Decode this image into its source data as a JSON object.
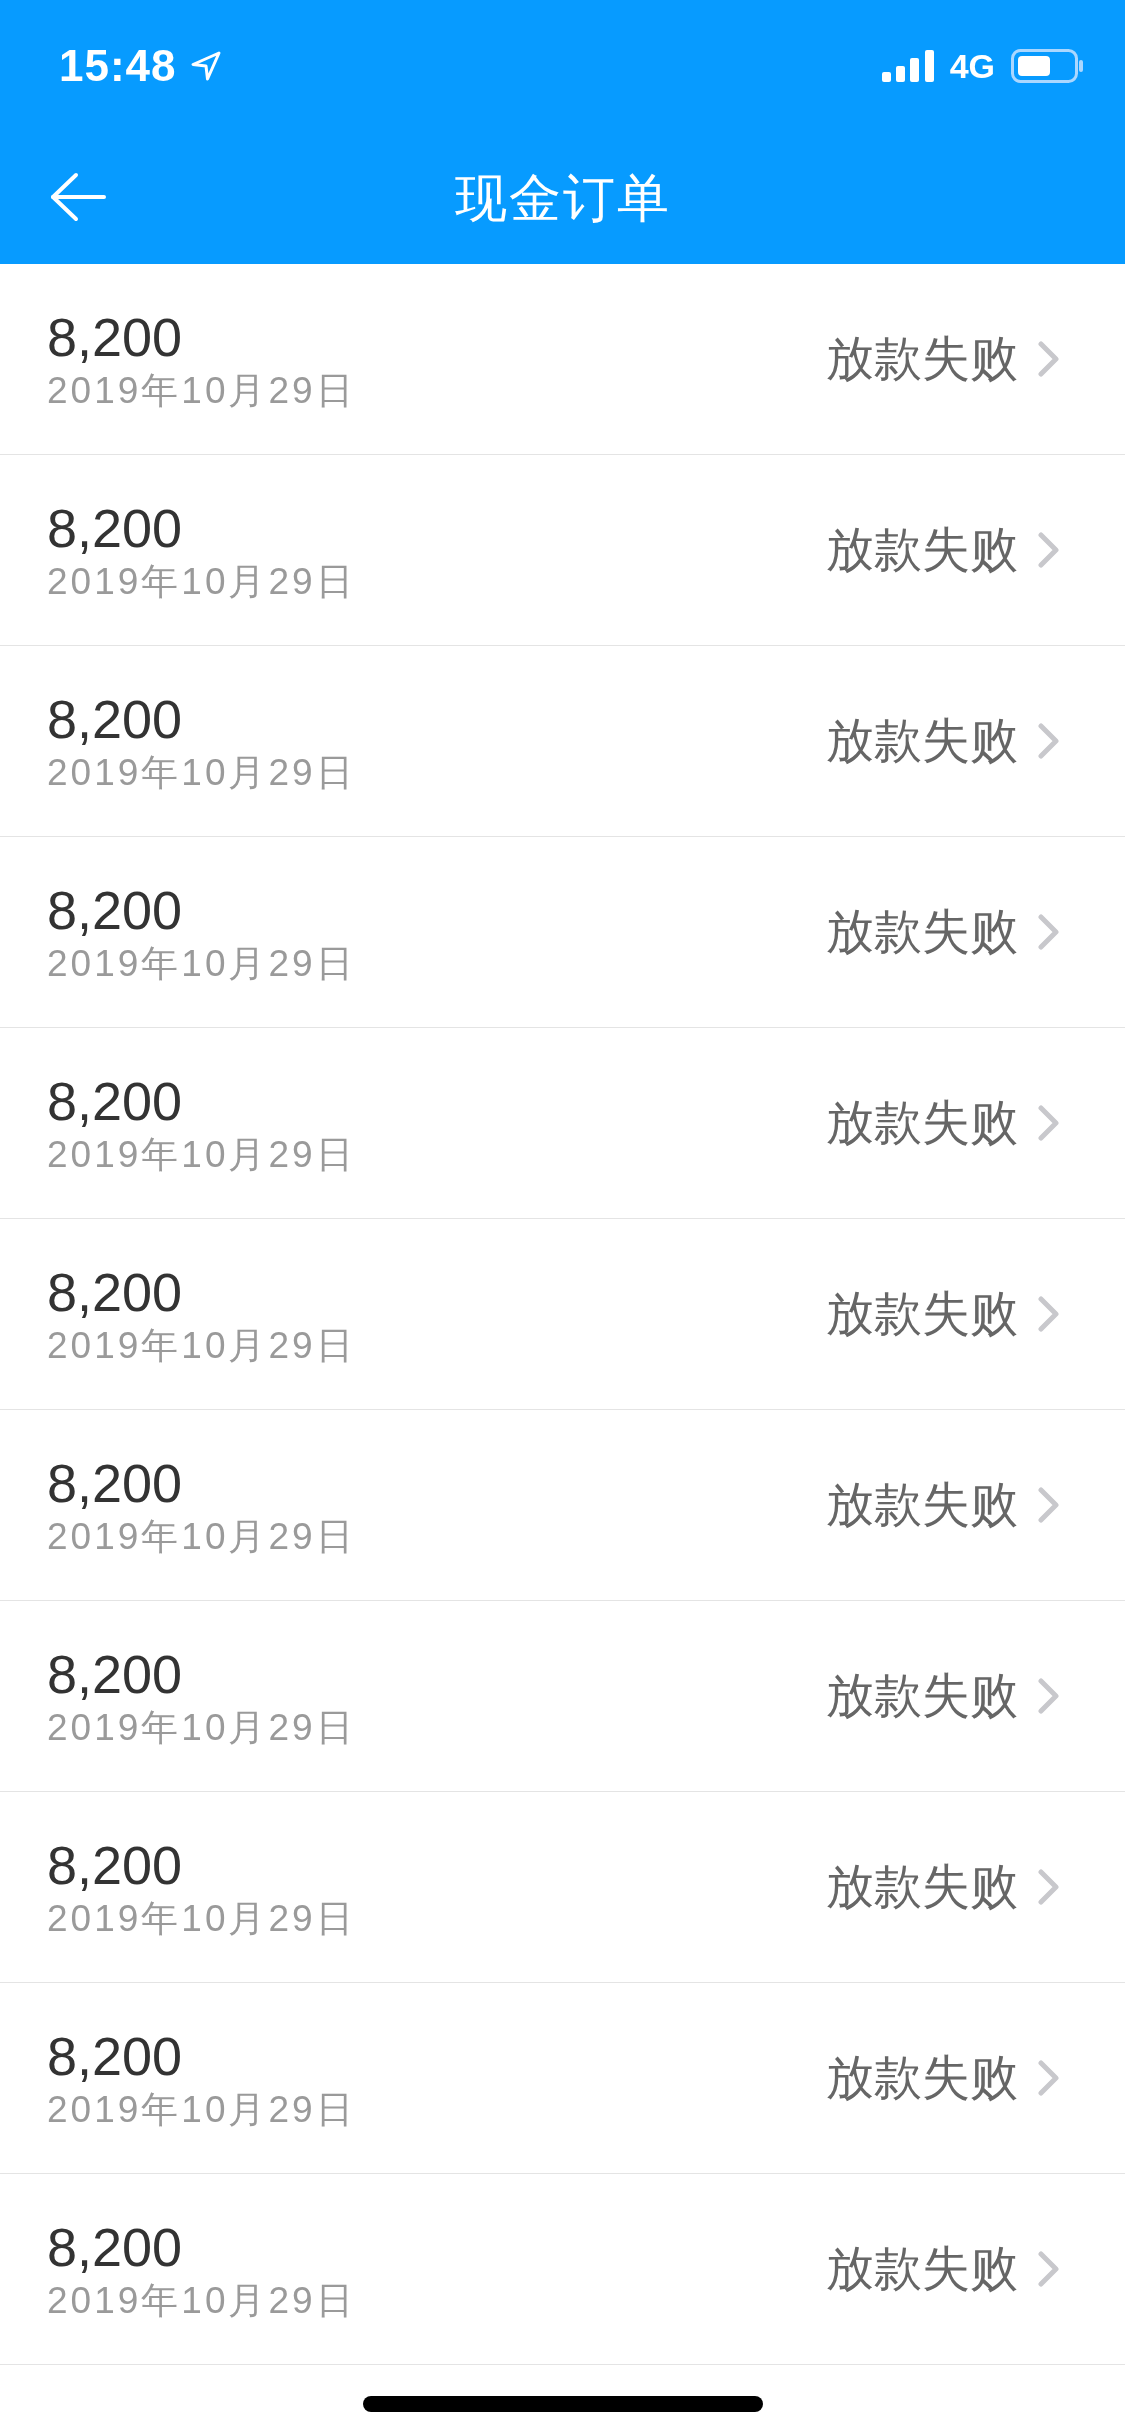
{
  "status_bar": {
    "time": "15:48",
    "network": "4G"
  },
  "nav_bar": {
    "title": "现金订单"
  },
  "orders": [
    {
      "amount": "8,200",
      "date": "2019年10月29日",
      "status": "放款失败"
    },
    {
      "amount": "8,200",
      "date": "2019年10月29日",
      "status": "放款失败"
    },
    {
      "amount": "8,200",
      "date": "2019年10月29日",
      "status": "放款失败"
    },
    {
      "amount": "8,200",
      "date": "2019年10月29日",
      "status": "放款失败"
    },
    {
      "amount": "8,200",
      "date": "2019年10月29日",
      "status": "放款失败"
    },
    {
      "amount": "8,200",
      "date": "2019年10月29日",
      "status": "放款失败"
    },
    {
      "amount": "8,200",
      "date": "2019年10月29日",
      "status": "放款失败"
    },
    {
      "amount": "8,200",
      "date": "2019年10月29日",
      "status": "放款失败"
    },
    {
      "amount": "8,200",
      "date": "2019年10月29日",
      "status": "放款失败"
    },
    {
      "amount": "8,200",
      "date": "2019年10月29日",
      "status": "放款失败"
    },
    {
      "amount": "8,200",
      "date": "2019年10月29日",
      "status": "放款失败"
    }
  ]
}
